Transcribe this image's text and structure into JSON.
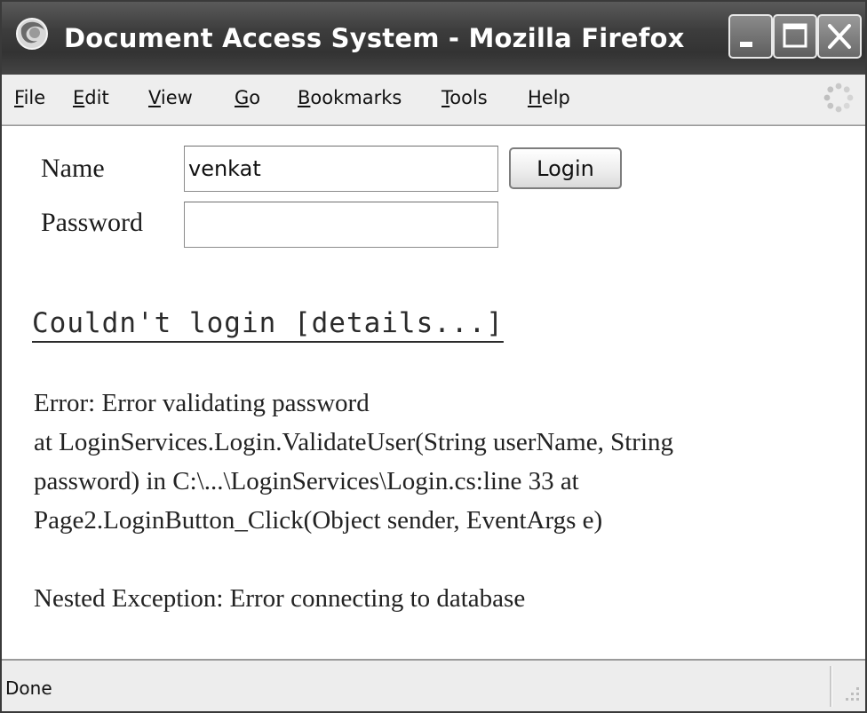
{
  "window": {
    "title": "Document Access System - Mozilla Firefox"
  },
  "icons": {
    "app": "firefox-icon",
    "minimize": "minimize-icon",
    "maximize": "maximize-icon",
    "close": "close-icon",
    "throbber": "loading-throbber-icon",
    "grip": "resize-grip-icon"
  },
  "menubar": {
    "items": [
      {
        "accel": "F",
        "rest": "ile"
      },
      {
        "accel": "E",
        "rest": "dit"
      },
      {
        "accel": "V",
        "rest": "iew"
      },
      {
        "accel": "G",
        "rest": "o"
      },
      {
        "accel": "B",
        "rest": "ookmarks"
      },
      {
        "accel": "T",
        "rest": "ools"
      },
      {
        "accel": "H",
        "rest": "elp"
      }
    ]
  },
  "form": {
    "name_label": "Name",
    "name_value": "venkat",
    "password_label": "Password",
    "password_value": "",
    "login_label": "Login"
  },
  "error": {
    "link_text": "Couldn't login [details...]",
    "lines": [
      "Error: Error validating password",
      "at LoginServices.Login.ValidateUser(String userName, String",
      "password) in C:\\...\\LoginServices\\Login.cs:line 33 at",
      "Page2.LoginButton_Click(Object sender, EventArgs e)"
    ],
    "nested": "Nested Exception: Error connecting to database"
  },
  "status": {
    "text": "Done"
  }
}
